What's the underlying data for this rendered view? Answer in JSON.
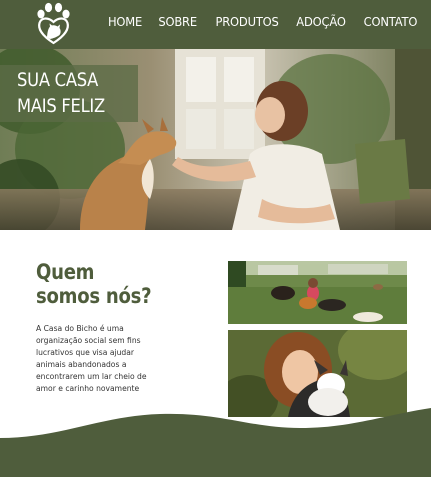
{
  "nav": {
    "items": [
      "HOME",
      "SOBRE",
      "PRODUTOS",
      "ADOÇÃO",
      "CONTATO"
    ]
  },
  "logo": {
    "icon": "heart-paw-dog-icon",
    "color": "#ffffff"
  },
  "hero": {
    "title_line1": "SUA CASA",
    "title_line2": "MAIS FELIZ"
  },
  "about": {
    "title_line1": "Quem",
    "title_line2": "somos nós?",
    "text": "A Casa do Bicho é uma organização social sem fins lucrativos que visa ajudar animais abandonados a encontrarem um lar cheio de amor e carinho novamente"
  },
  "colors": {
    "brand_green": "#4f5d3c",
    "text_dark": "#333333",
    "background": "#ffffff"
  }
}
